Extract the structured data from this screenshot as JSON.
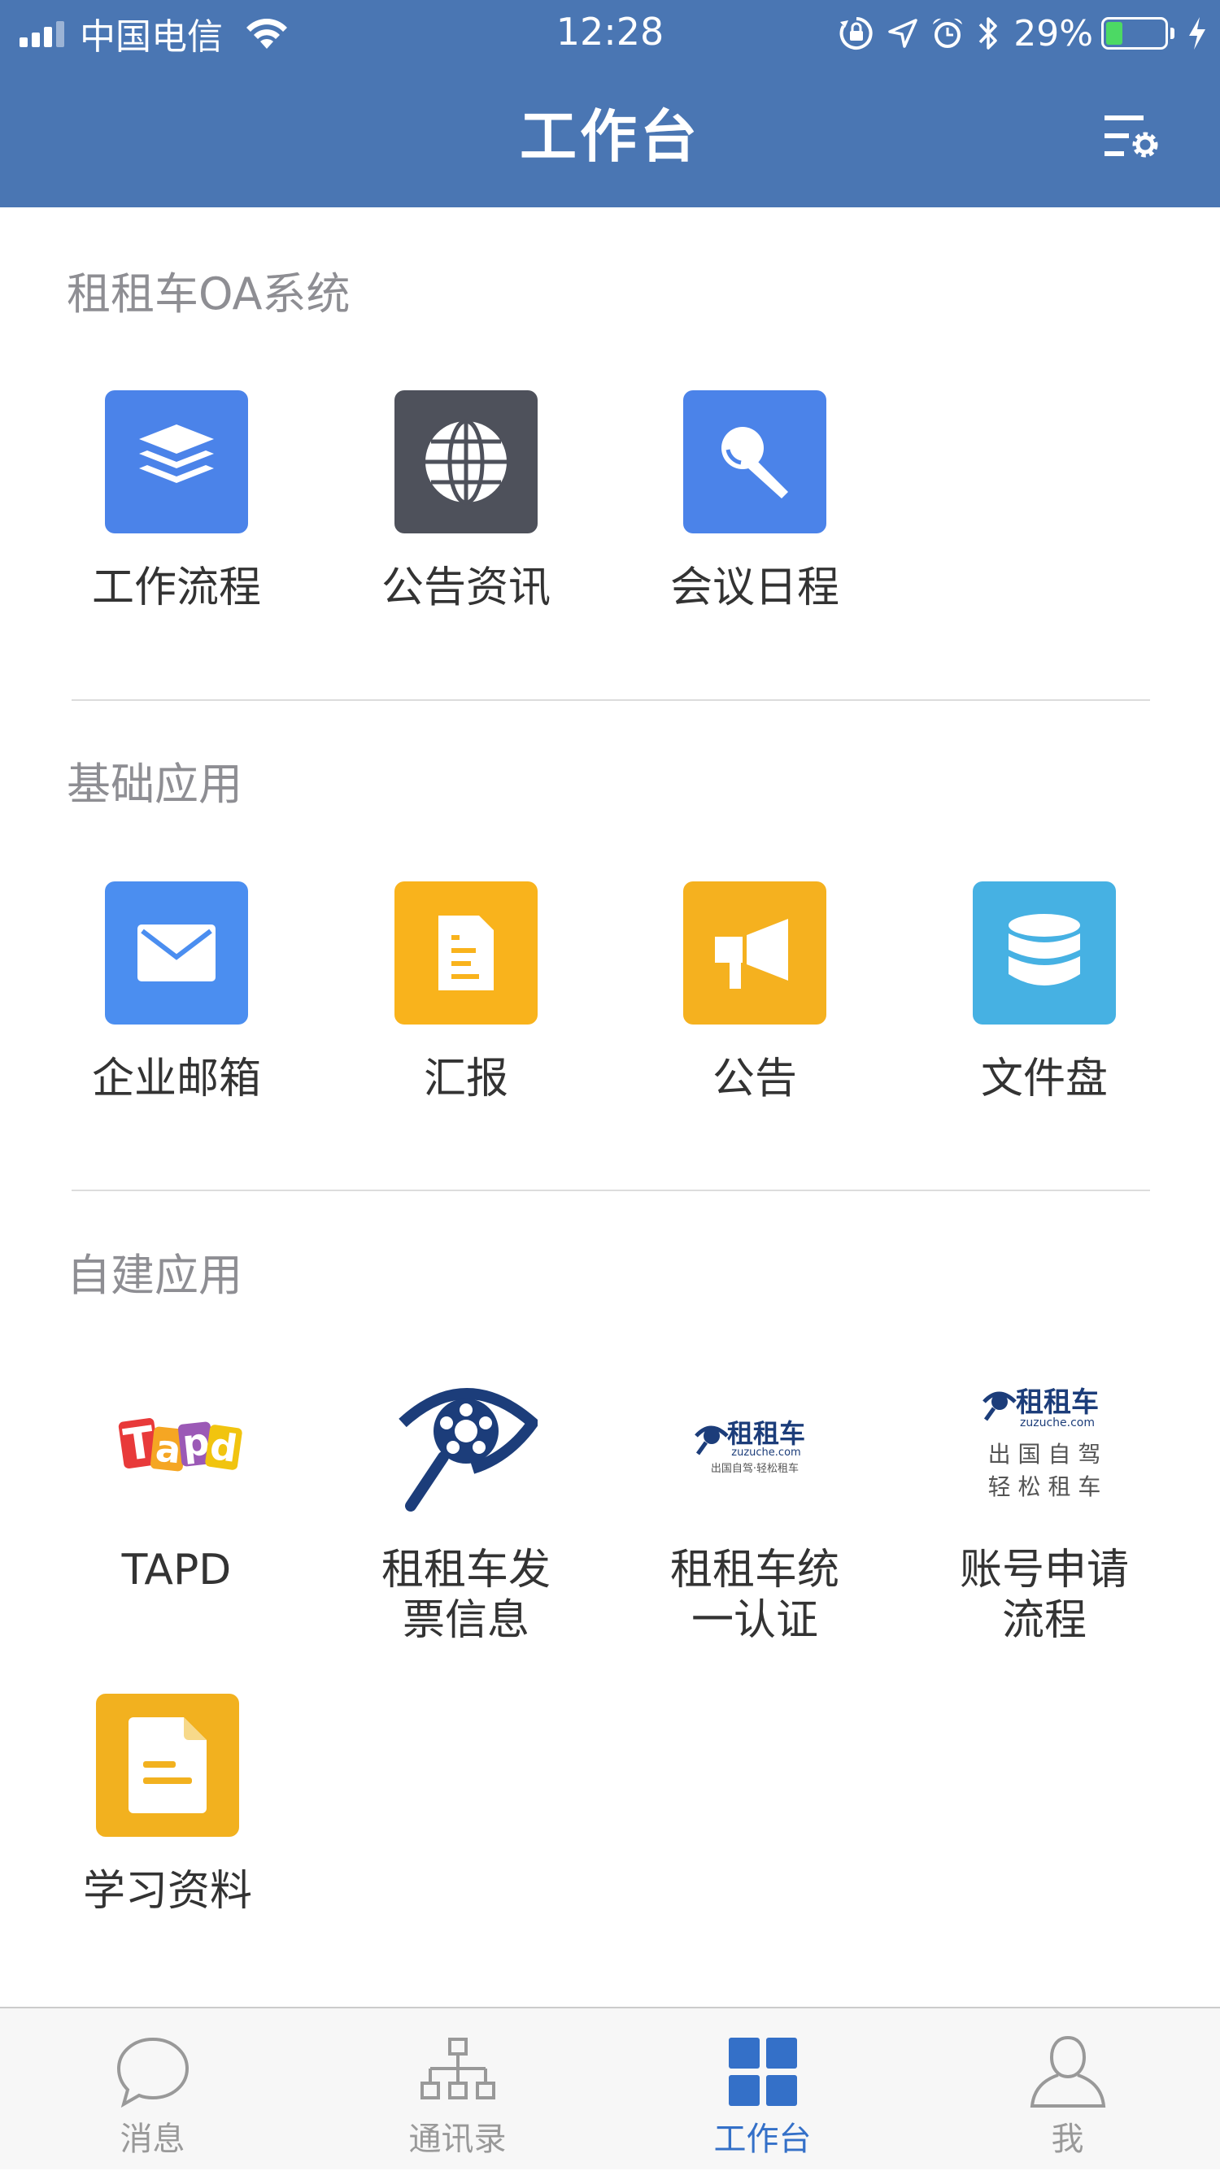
{
  "status_bar": {
    "carrier": "中国电信",
    "time": "12:28",
    "battery_percent": "29%",
    "battery_level": 0.29,
    "icons": [
      "signal-icon",
      "wifi-icon",
      "orientation-lock-icon",
      "location-icon",
      "alarm-icon",
      "bluetooth-icon",
      "battery-icon",
      "charging-icon"
    ]
  },
  "nav": {
    "title": "工作台",
    "settings_icon": "settings-icon"
  },
  "sections": [
    {
      "title": "租租车OA系统",
      "apps": [
        {
          "label": "工作流程",
          "icon": "layers-icon",
          "color": "#4b83e9"
        },
        {
          "label": "公告资讯",
          "icon": "globe-icon",
          "color": "#4e515b"
        },
        {
          "label": "会议日程",
          "icon": "microphone-icon",
          "color": "#4b83e9"
        }
      ]
    },
    {
      "title": "基础应用",
      "apps": [
        {
          "label": "企业邮箱",
          "icon": "mail-icon",
          "color": "#4b8ef0"
        },
        {
          "label": "汇报",
          "icon": "report-icon",
          "color": "#f9b31c"
        },
        {
          "label": "公告",
          "icon": "megaphone-icon",
          "color": "#f5b11f"
        },
        {
          "label": "文件盘",
          "icon": "database-icon",
          "color": "#46b1e3"
        }
      ]
    },
    {
      "title": "自建应用",
      "apps": [
        {
          "label": "TAPD",
          "icon": "tapd-logo"
        },
        {
          "label": "租租车发\n票信息",
          "label_line1": "租租车发",
          "label_line2": "票信息",
          "icon": "zuzuche-eye-logo",
          "color": "#1c3d7a"
        },
        {
          "label_line1": "租租车统",
          "label_line2": "一认证",
          "icon": "zuzuche-logo",
          "logo_text": "租租车",
          "logo_sub": "zuzuche.com",
          "logo_tagline": "出国自驾·轻松租车"
        },
        {
          "label_line1": "账号申请",
          "label_line2": "流程",
          "icon": "zuzuche-logo",
          "logo_text": "租租车",
          "logo_sub": "zuzuche.com",
          "logo_tagline1": "出 国 自 驾",
          "logo_tagline2": "轻 松 租 车"
        },
        {
          "label": "学习资料",
          "icon": "document-icon",
          "color": "#f2b11f"
        }
      ]
    }
  ],
  "tabbar": {
    "tabs": [
      {
        "label": "消息",
        "icon": "chat-bubble-icon"
      },
      {
        "label": "通讯录",
        "icon": "org-chart-icon"
      },
      {
        "label": "工作台",
        "icon": "grid-icon",
        "active": true
      },
      {
        "label": "我",
        "icon": "person-icon"
      }
    ],
    "active_color": "#3470c8",
    "inactive_color": "#999999"
  }
}
